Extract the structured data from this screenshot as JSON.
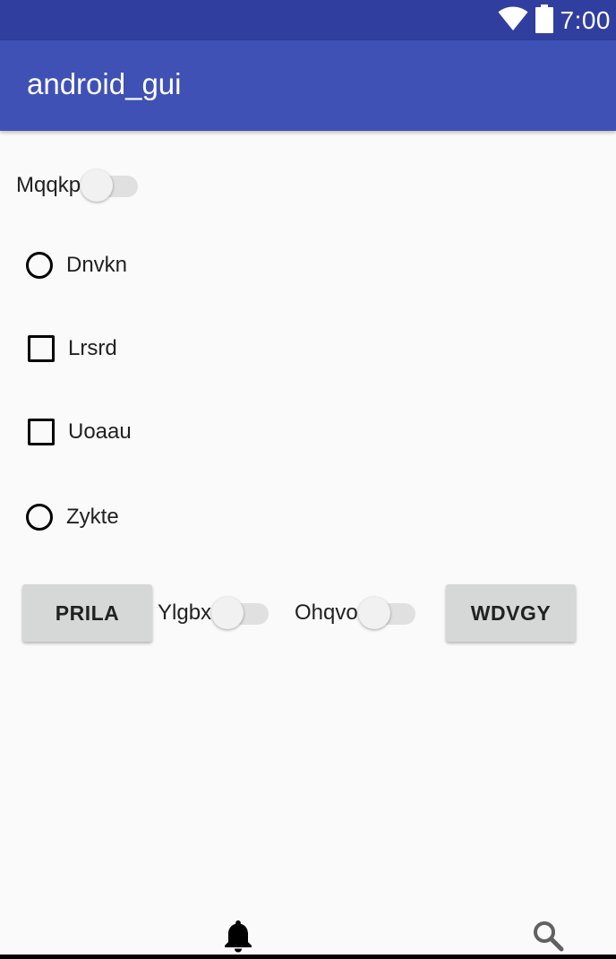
{
  "status_bar": {
    "time": "7:00",
    "icons": [
      "wifi-icon",
      "battery-icon"
    ]
  },
  "app_bar": {
    "title": "android_gui"
  },
  "switches": {
    "mqqkp": {
      "label": "Mqqkp",
      "checked": false
    },
    "ylgbx": {
      "label": "Ylgbx",
      "checked": false
    },
    "ohqvo": {
      "label": "Ohqvo",
      "checked": false
    }
  },
  "options": {
    "dnvkn": {
      "type": "radio",
      "label": "Dnvkn",
      "checked": false
    },
    "lrsrd": {
      "type": "checkbox",
      "label": "Lrsrd",
      "checked": false
    },
    "uoaau": {
      "type": "checkbox",
      "label": "Uoaau",
      "checked": false
    },
    "zykte": {
      "type": "radio",
      "label": "Zykte",
      "checked": false
    }
  },
  "buttons": {
    "prila": "PRILA",
    "wdvgy": "WDVGY"
  },
  "bottom_icons": [
    "bell-icon",
    "search-icon"
  ],
  "colors": {
    "status_bar": "#303f9f",
    "app_bar": "#3f51b5",
    "background": "#fafafa",
    "button": "#d6d7d7"
  }
}
